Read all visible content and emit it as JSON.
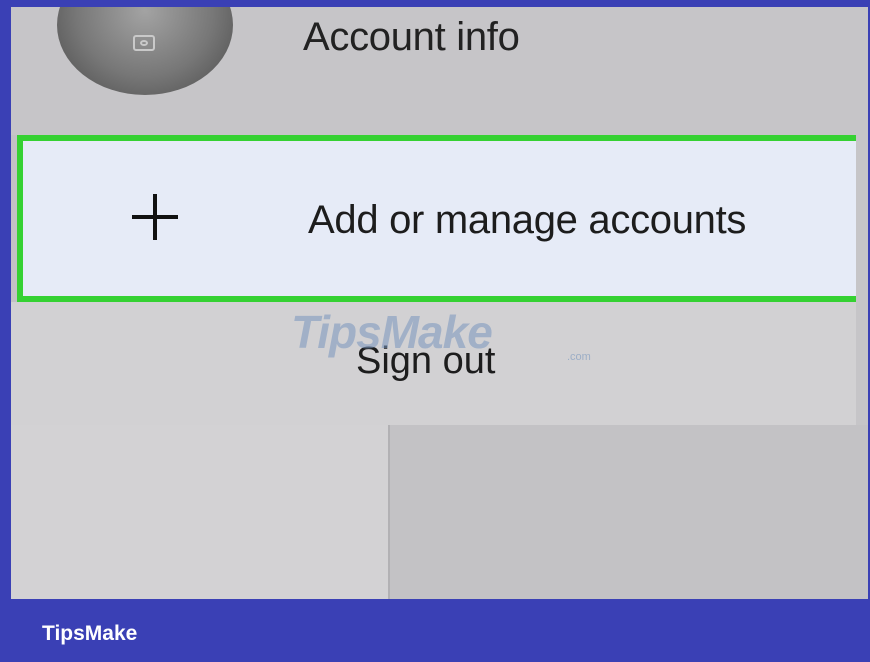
{
  "menu": {
    "account_info_label": "Account info",
    "add_accounts_label": "Add or manage accounts",
    "sign_out_label": "Sign out"
  },
  "icons": {
    "avatar": "camera-icon",
    "add": "plus-icon"
  },
  "watermark": {
    "text": "TipsMake",
    "suffix": ".com"
  },
  "footer": {
    "brand": "TipsMake"
  },
  "colors": {
    "highlight_border": "#35d132",
    "highlight_fill": "#e6ebf7",
    "frame": "#3a40b5"
  }
}
